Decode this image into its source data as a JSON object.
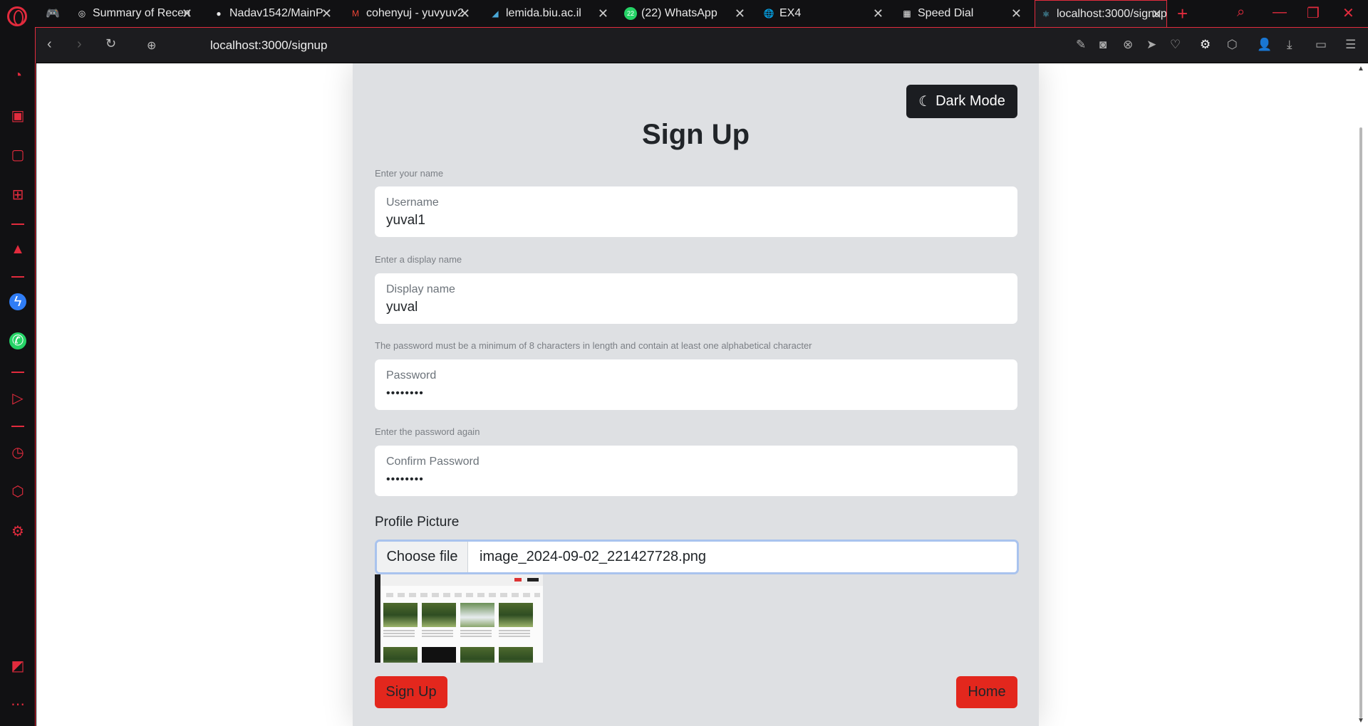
{
  "browser": {
    "tabs": [
      {
        "title": "Summary of Recen",
        "icon": "openai-icon"
      },
      {
        "title": "Nadav1542/MainP",
        "icon": "github-icon"
      },
      {
        "title": "cohenyuj - yuvyuv2",
        "icon": "gmail-icon"
      },
      {
        "title": "lemida.biu.ac.il",
        "icon": "moodle-icon"
      },
      {
        "title": "(22) WhatsApp",
        "icon": "whatsapp-icon",
        "badge": "22"
      },
      {
        "title": "EX4",
        "icon": "globe-icon"
      },
      {
        "title": "Speed Dial",
        "icon": "speed-dial-icon"
      },
      {
        "title": "localhost:3000/signup",
        "icon": "react-icon"
      }
    ],
    "url": "localhost:3000/signup",
    "accent": "#e22b3d"
  },
  "page": {
    "dark_mode_label": "Dark Mode",
    "title": "Sign Up",
    "name_hint": "Enter your name",
    "username_label": "Username",
    "username_value": "yuval1",
    "display_hint": "Enter a display name",
    "display_label": "Display name",
    "display_value": "yuval",
    "password_hint": "The password must be a minimum of 8 characters in length and contain at least one alphabetical character",
    "password_label": "Password",
    "password_value": "••••••••",
    "confirm_hint": "Enter the password again",
    "confirm_label": "Confirm Password",
    "confirm_value": "••••••••",
    "picture_label": "Profile Picture",
    "choose_file_label": "Choose file",
    "file_name": "image_2024-09-02_221427728.png",
    "signup_label": "Sign Up",
    "home_label": "Home",
    "button_color": "#e3271d"
  }
}
